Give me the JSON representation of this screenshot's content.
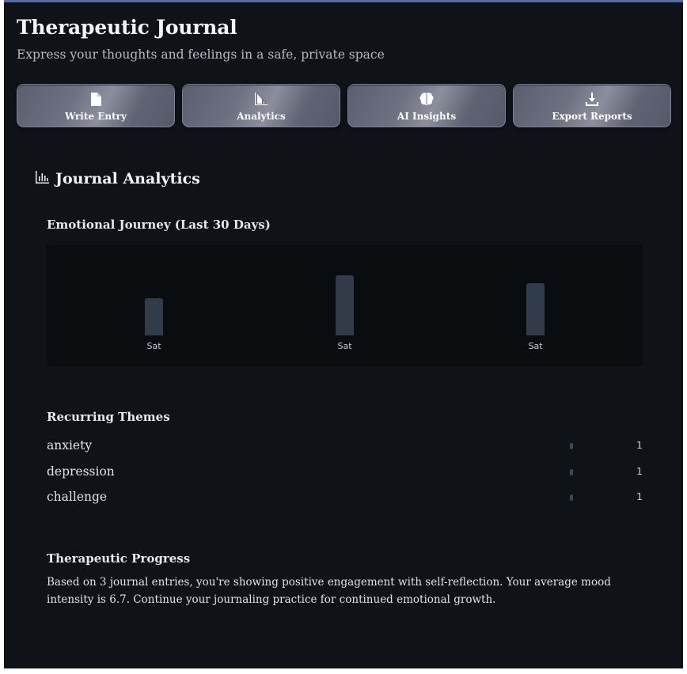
{
  "header": {
    "title": "Therapeutic Journal",
    "subtitle": "Express your thoughts and feelings in a safe, private space"
  },
  "tabs": [
    {
      "label": "Write Entry",
      "icon": "document-icon"
    },
    {
      "label": "Analytics",
      "icon": "chart-icon"
    },
    {
      "label": "AI Insights",
      "icon": "brain-icon"
    },
    {
      "label": "Export Reports",
      "icon": "download-icon"
    }
  ],
  "analytics": {
    "title": "Journal Analytics",
    "icon": "bar-chart-icon",
    "emotional_journey": {
      "title": "Emotional Journey (Last 30 Days)"
    },
    "recurring_themes": {
      "title": "Recurring Themes",
      "items": [
        {
          "name": "anxiety",
          "count": "1"
        },
        {
          "name": "depression",
          "count": "1"
        },
        {
          "name": "challenge",
          "count": "1"
        }
      ]
    },
    "progress": {
      "title": "Therapeutic Progress",
      "text": "Based on 3 journal entries, you're showing positive engagement with self-reflection. Your average mood intensity is 6.7. Continue your journaling practice for continued emotional growth."
    }
  },
  "chart_data": {
    "type": "bar",
    "categories": [
      "Sat",
      "Sat",
      "Sat"
    ],
    "values": [
      5,
      8,
      7
    ],
    "ylim": [
      0,
      10
    ],
    "bar_color": "#323b49",
    "background": "#0a0d10"
  },
  "colors": {
    "app_background": "#0f1318",
    "accent_border": "#5b6b9a"
  }
}
